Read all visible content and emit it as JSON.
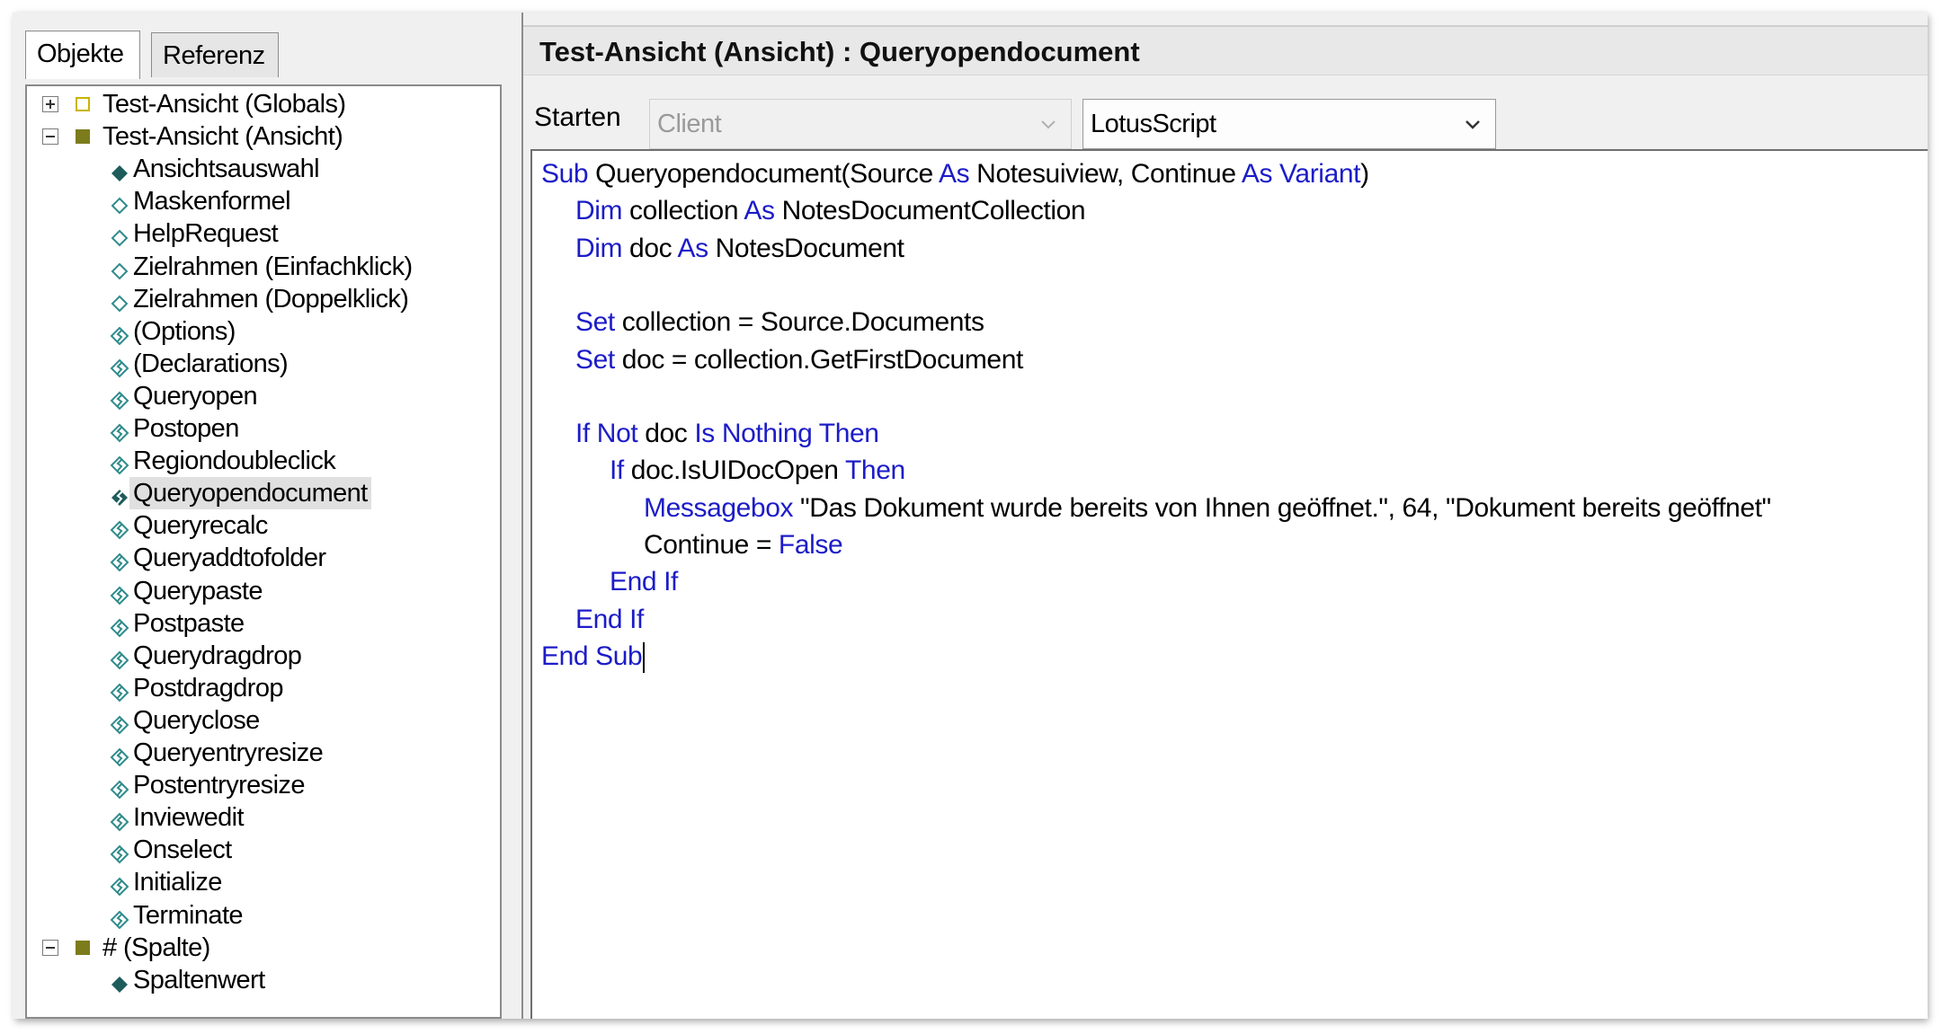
{
  "tabs": [
    {
      "label": "Objekte",
      "active": true
    },
    {
      "label": "Referenz",
      "active": false
    }
  ],
  "tree": [
    {
      "label": "Test-Ansicht (Globals)",
      "level": 0,
      "expander": "plus",
      "square": "hollow"
    },
    {
      "label": "Test-Ansicht (Ansicht)",
      "level": 0,
      "expander": "minus",
      "square": "filled"
    },
    {
      "label": "Ansichtsauswahl",
      "level": 1,
      "icon": "filled-diamond-icon"
    },
    {
      "label": "Maskenformel",
      "level": 1,
      "icon": "hollow-diamond-icon"
    },
    {
      "label": "HelpRequest",
      "level": 1,
      "icon": "hollow-diamond-icon"
    },
    {
      "label": "Zielrahmen (Einfachklick)",
      "level": 1,
      "icon": "hollow-diamond-icon"
    },
    {
      "label": "Zielrahmen (Doppelklick)",
      "level": 1,
      "icon": "hollow-diamond-icon"
    },
    {
      "label": "(Options)",
      "level": 1,
      "icon": "script-event-icon"
    },
    {
      "label": "(Declarations)",
      "level": 1,
      "icon": "script-event-icon"
    },
    {
      "label": "Queryopen",
      "level": 1,
      "icon": "script-event-icon"
    },
    {
      "label": "Postopen",
      "level": 1,
      "icon": "script-event-icon"
    },
    {
      "label": "Regiondoubleclick",
      "level": 1,
      "icon": "script-event-icon"
    },
    {
      "label": "Queryopendocument",
      "level": 1,
      "icon": "script-event-filled-icon",
      "selected": true
    },
    {
      "label": "Queryrecalc",
      "level": 1,
      "icon": "script-event-icon"
    },
    {
      "label": "Queryaddtofolder",
      "level": 1,
      "icon": "script-event-icon"
    },
    {
      "label": "Querypaste",
      "level": 1,
      "icon": "script-event-icon"
    },
    {
      "label": "Postpaste",
      "level": 1,
      "icon": "script-event-icon"
    },
    {
      "label": "Querydragdrop",
      "level": 1,
      "icon": "script-event-icon"
    },
    {
      "label": "Postdragdrop",
      "level": 1,
      "icon": "script-event-icon"
    },
    {
      "label": "Queryclose",
      "level": 1,
      "icon": "script-event-icon"
    },
    {
      "label": "Queryentryresize",
      "level": 1,
      "icon": "script-event-icon"
    },
    {
      "label": "Postentryresize",
      "level": 1,
      "icon": "script-event-icon"
    },
    {
      "label": "Inviewedit",
      "level": 1,
      "icon": "script-event-icon"
    },
    {
      "label": "Onselect",
      "level": 1,
      "icon": "script-event-icon"
    },
    {
      "label": "Initialize",
      "level": 1,
      "icon": "script-event-icon"
    },
    {
      "label": "Terminate",
      "level": 1,
      "icon": "script-event-icon"
    },
    {
      "label": "# (Spalte)",
      "level": 0,
      "expander": "minus",
      "square": "filled"
    },
    {
      "label": "Spaltenwert",
      "level": 1,
      "icon": "filled-diamond-icon"
    }
  ],
  "editor": {
    "title": "Test-Ansicht (Ansicht) : Queryopendocument",
    "run_label": "Starten",
    "run_target": "Client",
    "language": "LotusScript",
    "code": [
      {
        "indent": 0,
        "tokens": [
          {
            "t": "Sub",
            "kw": true
          },
          {
            "t": " Queryopendocument(Source "
          },
          {
            "t": "As",
            "kw": true
          },
          {
            "t": " Notesuiview, Continue "
          },
          {
            "t": "As Variant",
            "kw": true
          },
          {
            "t": ")"
          }
        ]
      },
      {
        "indent": 1,
        "tokens": [
          {
            "t": "Dim",
            "kw": true
          },
          {
            "t": " collection "
          },
          {
            "t": "As",
            "kw": true
          },
          {
            "t": " NotesDocumentCollection"
          }
        ]
      },
      {
        "indent": 1,
        "tokens": [
          {
            "t": "Dim",
            "kw": true
          },
          {
            "t": " doc "
          },
          {
            "t": "As",
            "kw": true
          },
          {
            "t": " NotesDocument"
          }
        ]
      },
      {
        "indent": 0,
        "tokens": []
      },
      {
        "indent": 1,
        "tokens": [
          {
            "t": "Set",
            "kw": true
          },
          {
            "t": " collection = Source.Documents"
          }
        ]
      },
      {
        "indent": 1,
        "tokens": [
          {
            "t": "Set",
            "kw": true
          },
          {
            "t": " doc = collection.GetFirstDocument"
          }
        ]
      },
      {
        "indent": 0,
        "tokens": []
      },
      {
        "indent": 1,
        "tokens": [
          {
            "t": "If Not",
            "kw": true
          },
          {
            "t": " doc "
          },
          {
            "t": "Is Nothing Then",
            "kw": true
          }
        ]
      },
      {
        "indent": 2,
        "tokens": [
          {
            "t": "If",
            "kw": true
          },
          {
            "t": " doc.IsUIDocOpen "
          },
          {
            "t": "Then",
            "kw": true
          }
        ]
      },
      {
        "indent": 3,
        "tokens": [
          {
            "t": "Messagebox",
            "kw": true
          },
          {
            "t": " \"Das Dokument wurde bereits von Ihnen geöffnet.\", 64, \"Dokument bereits geöffnet\""
          }
        ]
      },
      {
        "indent": 3,
        "tokens": [
          {
            "t": "Continue = "
          },
          {
            "t": "False",
            "kw": true
          }
        ]
      },
      {
        "indent": 2,
        "tokens": [
          {
            "t": "End If",
            "kw": true
          }
        ]
      },
      {
        "indent": 1,
        "tokens": [
          {
            "t": "End If",
            "kw": true
          }
        ]
      },
      {
        "indent": 0,
        "tokens": [
          {
            "t": "End Sub",
            "kw": true
          }
        ],
        "cursor": true
      }
    ]
  },
  "colors": {
    "keyword": "#1c1cc8",
    "icon_teal": "#2e8b8b",
    "icon_dark": "#1e5c5c",
    "tree_square_filled": "#7c7c1c",
    "tree_square_hollow": "#c8b400"
  }
}
